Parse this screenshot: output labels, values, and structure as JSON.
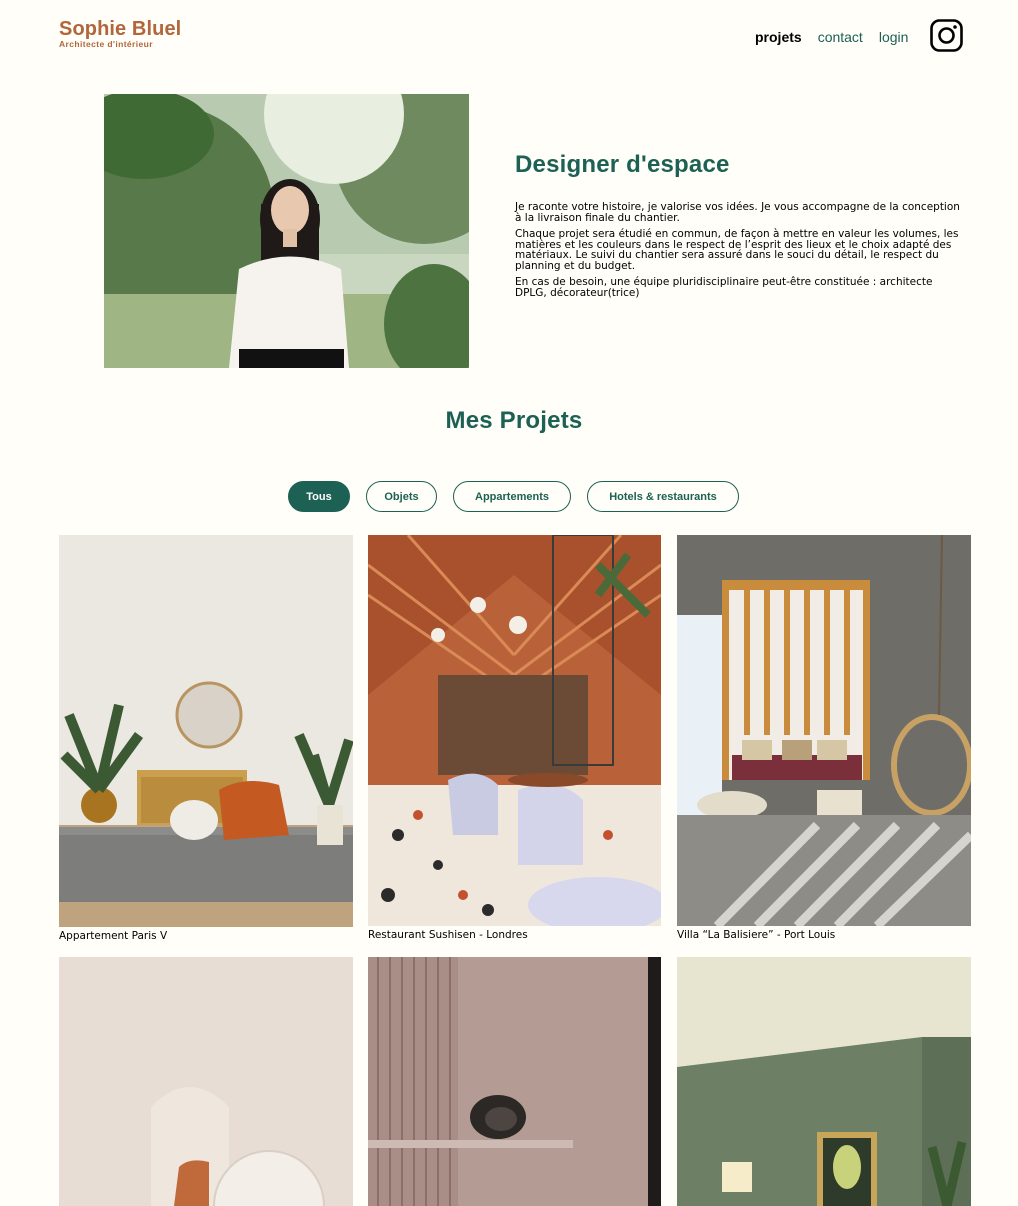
{
  "header": {
    "brand_name": "Sophie Bluel",
    "brand_subtitle": "Architecte d'intérieur",
    "nav": [
      {
        "label": "projets",
        "active": true
      },
      {
        "label": "contact",
        "active": false
      },
      {
        "label": "login",
        "active": false
      }
    ],
    "social_icon": "instagram-icon"
  },
  "intro": {
    "title": "Designer d'espace",
    "paragraphs": [
      "Je raconte votre histoire, je valorise vos idées. Je vous accompagne de la conception à la livraison finale du chantier.",
      "Chaque projet sera étudié en commun, de façon à mettre en valeur les volumes, les matières et les couleurs dans le respect de l’esprit des lieux et le choix adapté des matériaux. Le suivi du chantier sera assuré dans le souci du détail, le respect du planning et du budget.",
      "En cas de besoin, une équipe pluridisciplinaire peut-être constituée : architecte DPLG, décorateur(trice)"
    ]
  },
  "projects": {
    "title": "Mes Projets",
    "filters": [
      {
        "label": "Tous",
        "active": true
      },
      {
        "label": "Objets",
        "active": false
      },
      {
        "label": "Appartements",
        "active": false
      },
      {
        "label": "Hotels & restaurants",
        "active": false
      }
    ],
    "gallery": [
      {
        "caption": "Appartement Paris V"
      },
      {
        "caption": "Restaurant Sushisen - Londres"
      },
      {
        "caption": "Villa “La Balisiere” - Port Louis"
      },
      {
        "caption": ""
      },
      {
        "caption": ""
      },
      {
        "caption": ""
      }
    ]
  },
  "colors": {
    "background": "#FFFEF8",
    "brand": "#B1663C",
    "accent": "#1D6154"
  }
}
